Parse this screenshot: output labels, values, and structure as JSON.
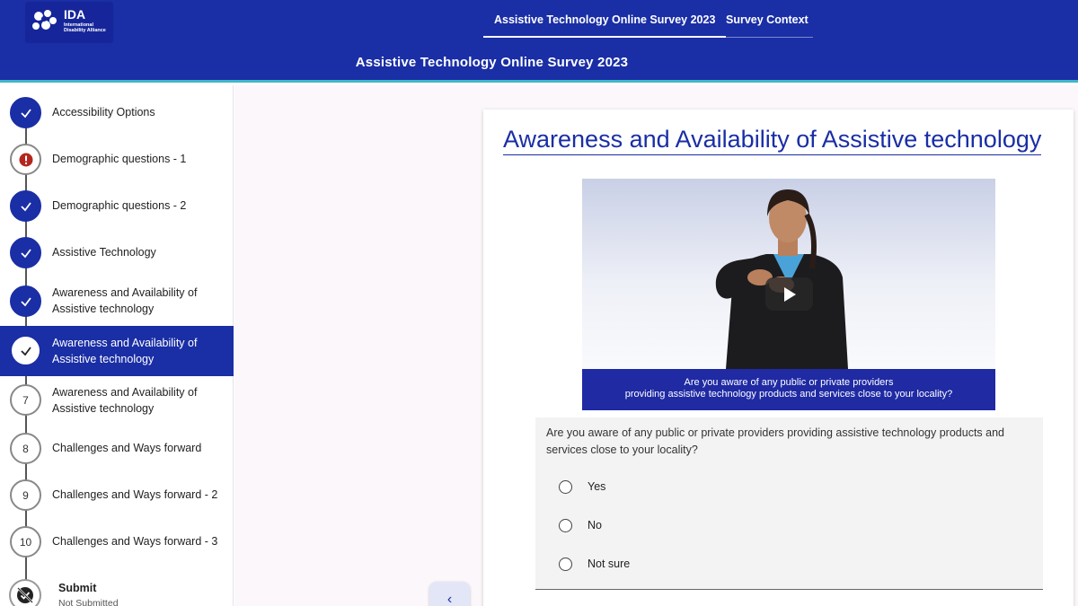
{
  "header": {
    "logo_text": "IDA",
    "logo_sub": "International Disability Alliance",
    "nav": [
      {
        "label": "Assistive Technology Online Survey 2023"
      },
      {
        "label": "Survey Context"
      }
    ],
    "title": "Assistive Technology Online Survey 2023"
  },
  "sidebar": {
    "steps": [
      {
        "label": "Accessibility Options",
        "status": "done",
        "icon": "check-icon"
      },
      {
        "label": "Demographic questions - 1",
        "status": "error",
        "icon": "error-icon"
      },
      {
        "label": "Demographic questions - 2",
        "status": "done",
        "icon": "check-icon"
      },
      {
        "label": "Assistive Technology",
        "status": "done",
        "icon": "check-icon"
      },
      {
        "label": "Awareness and Availability of Assistive technology",
        "status": "done",
        "icon": "check-icon"
      },
      {
        "label": "Awareness and Availability of Assistive technology",
        "status": "current",
        "icon": "check-icon"
      },
      {
        "label": "Awareness and Availability of Assistive technology",
        "number": "7"
      },
      {
        "label": "Challenges and Ways forward",
        "number": "8"
      },
      {
        "label": "Challenges and Ways forward - 2",
        "number": "9"
      },
      {
        "label": "Challenges and Ways forward - 3",
        "number": "10"
      }
    ],
    "submit": {
      "title": "Submit",
      "status": "Not Submitted",
      "icon": "not-submitted-icon"
    }
  },
  "main": {
    "heading": "Awareness and Availability of Assistive technology",
    "video": {
      "caption_line1": "Are you aware of any public or private providers",
      "caption_line2": "providing assistive technology products and services close to your locality?",
      "play_icon": "play-icon"
    },
    "question": {
      "text": "Are you aware of any public or private providers providing assistive technology products and services close to your locality?",
      "options": [
        {
          "label": "Yes"
        },
        {
          "label": "No"
        },
        {
          "label": "Not sure"
        }
      ]
    },
    "back_icon": "chevron-left-icon"
  },
  "colors": {
    "primary": "#1a2ea5",
    "header_accent": "#3fb6c8",
    "error": "#b3261e"
  }
}
